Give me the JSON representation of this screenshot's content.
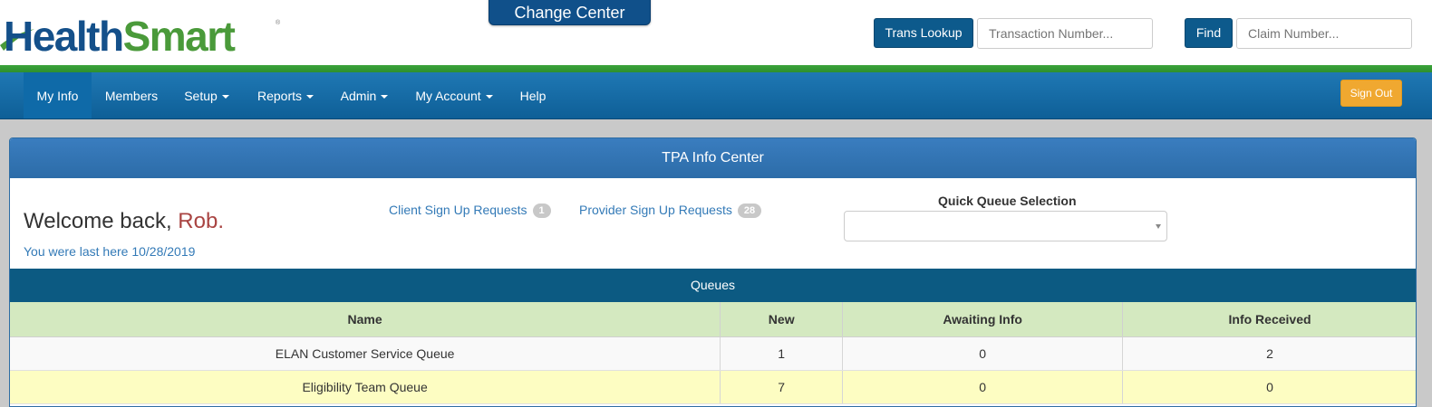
{
  "header": {
    "logo_health": "Health",
    "logo_smart": "Smart",
    "change_center": "Change Center",
    "trans_lookup": "Trans Lookup",
    "transaction_placeholder": "Transaction Number...",
    "find": "Find",
    "claim_placeholder": "Claim Number..."
  },
  "nav": {
    "items": [
      "My Info",
      "Members",
      "Setup",
      "Reports",
      "Admin",
      "My Account",
      "Help"
    ],
    "sign_out": "Sign Out"
  },
  "panel": {
    "title": "TPA Info Center",
    "welcome_prefix": "Welcome back,",
    "welcome_name": "Rob.",
    "last_here": "You were last here 10/28/2019",
    "client_link": "Client Sign Up Requests",
    "client_count": "1",
    "provider_link": "Provider Sign Up Requests",
    "provider_count": "28",
    "quick_queue_label": "Quick Queue Selection",
    "quick_queue_value": ""
  },
  "queues": {
    "title": "Queues",
    "columns": [
      "Name",
      "New",
      "Awaiting Info",
      "Info Received"
    ],
    "rows": [
      [
        "ELAN Customer Service Queue",
        "1",
        "0",
        "2"
      ],
      [
        "Eligibility Team Queue",
        "7",
        "0",
        "0"
      ]
    ]
  },
  "colors": {
    "brand_blue": "#14508a",
    "brand_green": "#4a9a3a",
    "sign_out": "#f0a830",
    "queue_header": "#d4e9c0",
    "highlight_row": "#fdfdc2"
  }
}
